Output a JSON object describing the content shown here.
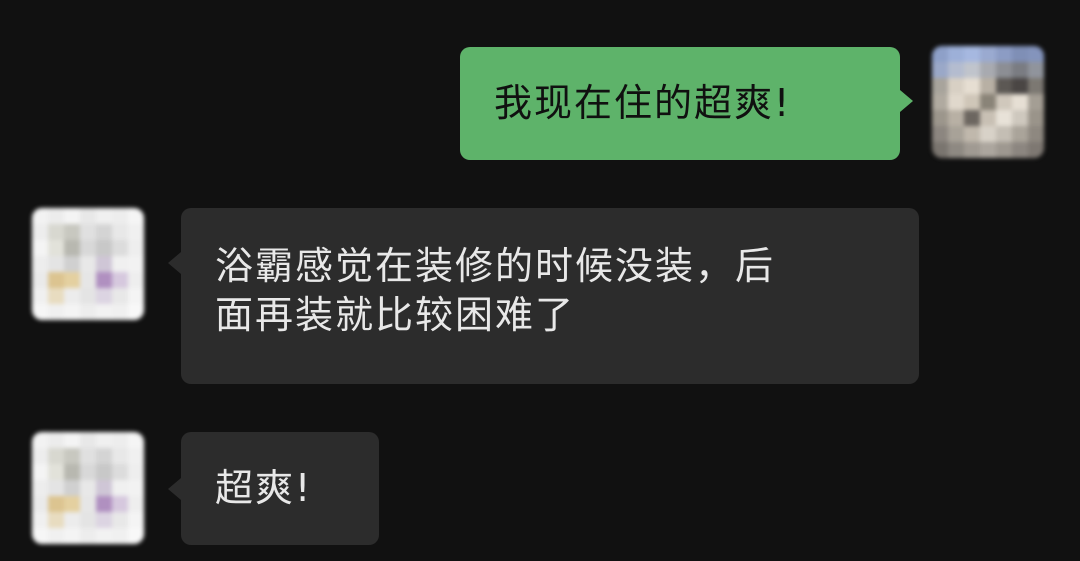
{
  "messages": [
    {
      "sender": "me",
      "text": "我现在住的超爽!"
    },
    {
      "sender": "other",
      "text_lines": [
        "浴霸感觉在装修的时候没装，后",
        "面再装就比较困难了"
      ]
    },
    {
      "sender": "other",
      "text": "超爽!"
    }
  ],
  "colors": {
    "background": "#111111",
    "incoming_bubble": "#2c2c2c",
    "outgoing_bubble": "#5eb36a",
    "incoming_text": "#e8e8e8",
    "outgoing_text": "#101010"
  },
  "avatars": {
    "me": "pixelated-photo-avatar",
    "other": "pixelated-photo-avatar"
  }
}
